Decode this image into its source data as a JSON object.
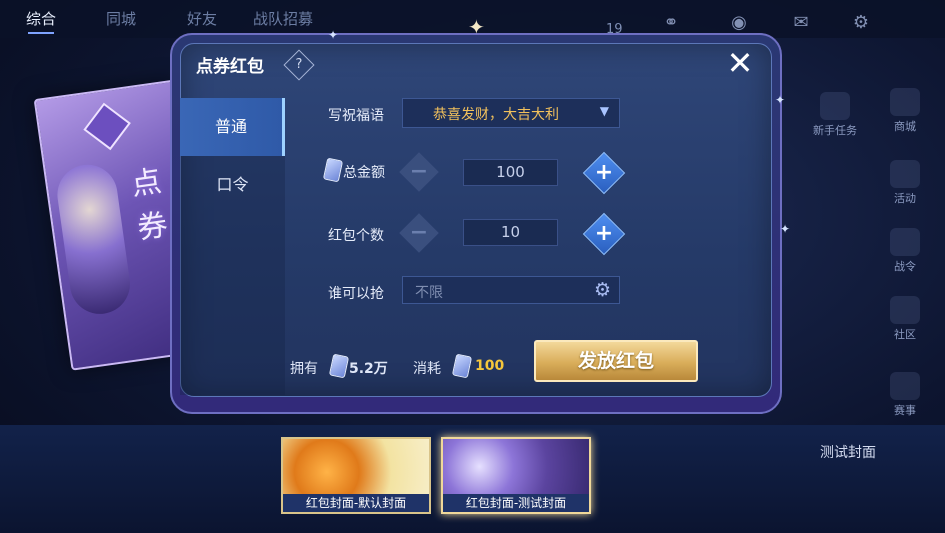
{
  "nav": {
    "tabs": [
      "综合",
      "同城",
      "好友",
      "战队招募"
    ],
    "active_tab": "综合",
    "count": "19"
  },
  "side_menu": [
    "新手任务",
    "商城",
    "活动",
    "战令",
    "社区",
    "赛事"
  ],
  "dialog": {
    "title": "点券红包",
    "help_icon": "?",
    "close_icon": "✕",
    "tabs": [
      {
        "label": "普通",
        "active": true
      },
      {
        "label": "口令",
        "active": false
      }
    ],
    "blessing": {
      "label": "写祝福语",
      "value": "恭喜发财，大吉大利"
    },
    "total_amount": {
      "label": "总金额",
      "value": "100"
    },
    "packet_count": {
      "label": "红包个数",
      "value": "10"
    },
    "who_can_grab": {
      "label": "谁可以抢",
      "value": "不限"
    },
    "owned": {
      "label": "拥有",
      "value": "5.2万"
    },
    "cost": {
      "label": "消耗",
      "value": "100"
    },
    "send_button": "发放红包"
  },
  "envelope_preview": {
    "text": "点券"
  },
  "covers": {
    "right_label": "测试封面",
    "items": [
      {
        "label": "红包封面-默认封面",
        "selected": false
      },
      {
        "label": "红包封面-测试封面",
        "selected": true
      }
    ]
  },
  "colors": {
    "accent": "#f5c63b",
    "button_gold": "#d9ad5a",
    "panel": "#2f4678"
  }
}
